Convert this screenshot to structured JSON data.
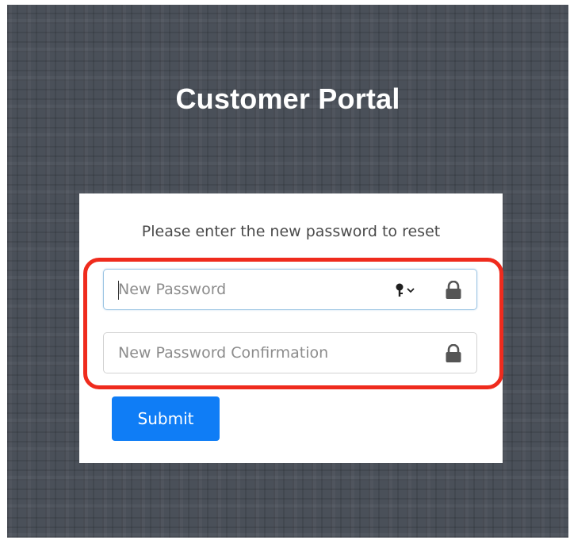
{
  "page": {
    "title": "Customer Portal"
  },
  "reset_form": {
    "instruction": "Please enter the new password to reset",
    "new_password": {
      "value": "",
      "placeholder": "New Password",
      "lock_icon": "lock-icon",
      "keychain_icon": "key-icon"
    },
    "new_password_confirmation": {
      "value": "",
      "placeholder": "New Password Confirmation",
      "lock_icon": "lock-icon"
    },
    "submit_label": "Submit"
  },
  "colors": {
    "background": "#4a5059",
    "card": "#ffffff",
    "submit_button": "#0f7df6",
    "highlight_outline": "#ef2b1d",
    "focused_border": "#9ec6e4"
  }
}
